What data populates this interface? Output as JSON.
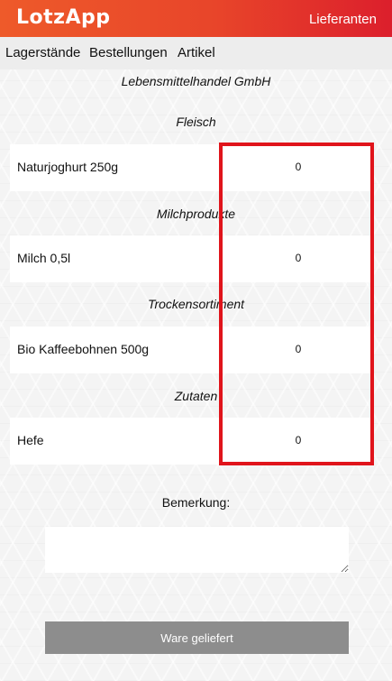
{
  "app": {
    "logo": "LotzApp",
    "supplier_link": "Lieferanten"
  },
  "nav": {
    "items": [
      "Lagerstände",
      "Bestellungen",
      "Artikel"
    ]
  },
  "supplier": {
    "name": "Lebensmittelhandel GmbH"
  },
  "categories": [
    {
      "name": "Fleisch",
      "items": [
        {
          "name": "Naturjoghurt 250g",
          "qty": "0"
        }
      ]
    },
    {
      "name": "Milchprodukte",
      "items": [
        {
          "name": "Milch 0,5l",
          "qty": "0"
        }
      ]
    },
    {
      "name": "Trockensortiment",
      "items": [
        {
          "name": "Bio Kaffeebohnen 500g",
          "qty": "0"
        }
      ]
    },
    {
      "name": "Zutaten",
      "items": [
        {
          "name": "Hefe",
          "qty": "0"
        }
      ]
    }
  ],
  "remark": {
    "label": "Bemerkung:",
    "value": ""
  },
  "submit": {
    "label": "Ware geliefert"
  },
  "colors": {
    "highlight": "#e0141b",
    "button": "#8d8d8d",
    "brand_start": "#ee5a2a",
    "brand_end": "#dc1f2c"
  }
}
